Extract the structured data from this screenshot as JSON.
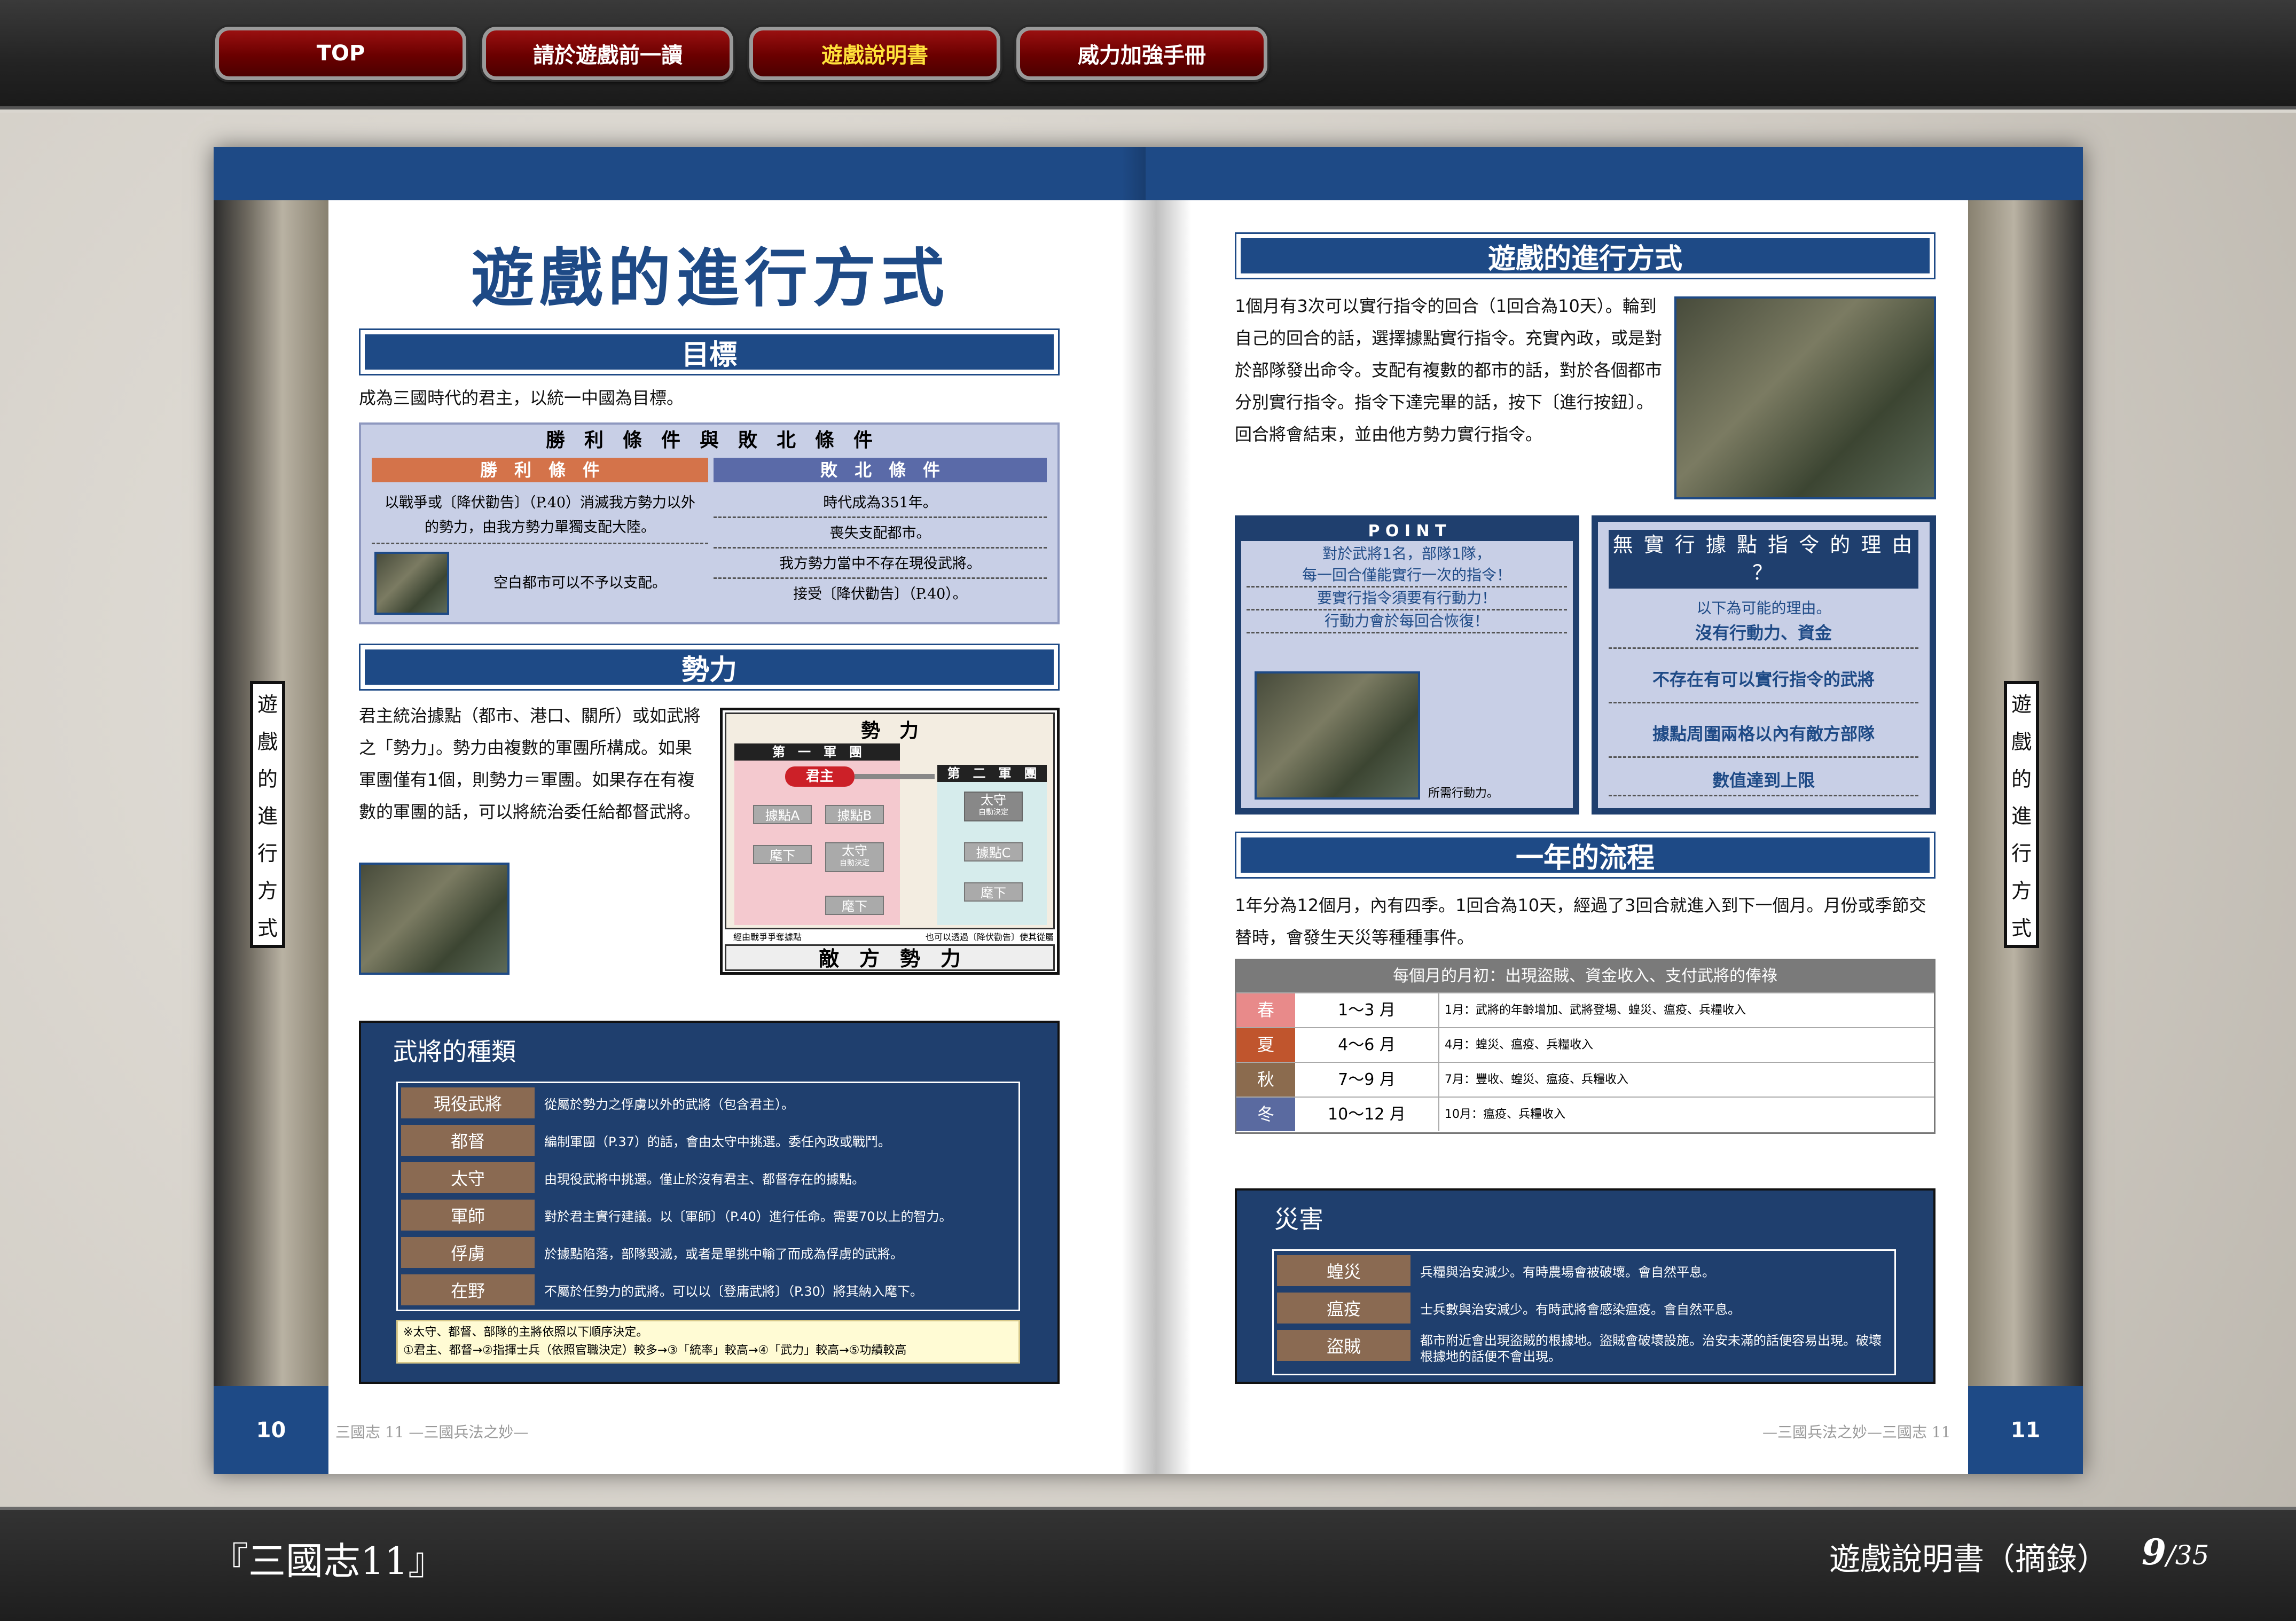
{
  "nav": {
    "items": [
      {
        "label": "TOP"
      },
      {
        "label": "請於遊戲前一讀"
      },
      {
        "label": "遊戲說明書"
      },
      {
        "label": "威力加強手冊"
      }
    ],
    "active_index": 2
  },
  "footer": {
    "title": "『三國志11』",
    "section": "遊戲說明書（摘錄）",
    "page_current": "9",
    "page_total": "/35"
  },
  "left_page": {
    "page_number": "10",
    "running_head": "三國志 11 —三國兵法之妙—",
    "side_tab": [
      "遊",
      "戲",
      "的",
      "進",
      "行",
      "方",
      "式"
    ],
    "title": "遊戲的進行方式",
    "goal": {
      "heading": "目標",
      "text": "成為三國時代的君主，以統一中國為目標。",
      "table_title": "勝　利　條　件　與　敗　北　條　件",
      "win_header": "勝　利　條　件",
      "lose_header": "敗　北　條　件",
      "win_1": "以戰爭或〔降伏勸告〕（P.40）消滅我方勢力以外的勢力，由我方勢力單獨支配大陸。",
      "win_2": "空白都市可以不予以支配。",
      "lose": [
        "時代成為351年。",
        "喪失支配都市。",
        "我方勢力當中不存在現役武將。",
        "接受〔降伏勸告〕（P.40）。"
      ]
    },
    "power": {
      "heading": "勢力",
      "text": "君主統治據點（都市、港口、關所）或如武將之「勢力」。勢力由複數的軍團所構成。如果軍團僅有1個，則勢力＝軍團。如果存在有複數的軍團的話，可以將統治委任給都督武將。",
      "diagram": {
        "title": "勢　力",
        "corps1": "第　一　軍　團",
        "corps2": "第　二　軍　團",
        "lord": "君主",
        "baseA": "據點A",
        "baseB": "據點B",
        "sub1": "麾下",
        "taishou1": "太守",
        "taishou1_note": "自動決定",
        "sub2": "麾下",
        "taishou2": "太守",
        "taishou2_note": "自動決定",
        "baseC": "據點C",
        "sub3": "麾下",
        "note_left": "經由戰爭爭奪據點",
        "note_right": "也可以透過〔降伏勸告〕使其從屬",
        "enemy": "敵　方　勢　力"
      }
    },
    "generals": {
      "heading": "武將的種類",
      "rows": [
        {
          "label": "現役武將",
          "desc": "從屬於勢力之俘虜以外的武將（包含君主）。"
        },
        {
          "label": "都督",
          "desc": "編制軍團（P.37）的話，會由太守中挑選。委任內政或戰鬥。"
        },
        {
          "label": "太守",
          "desc": "由現役武將中挑選。僅止於沒有君主、都督存在的據點。"
        },
        {
          "label": "軍師",
          "desc": "對於君主實行建議。以〔軍師〕（P.40）進行任命。需要70以上的智力。"
        },
        {
          "label": "俘虜",
          "desc": "於據點陷落，部隊毀滅，或者是單挑中輸了而成為俘虜的武將。"
        },
        {
          "label": "在野",
          "desc": "不屬於任勢力的武將。可以以〔登庸武將〕（P.30）將其納入麾下。"
        }
      ],
      "note_1": "※太守、都督、部隊的主將依照以下順序決定。",
      "note_2": "①君主、都督→②指揮士兵（依照官職決定）較多→③「統率」較高→④「武力」較高→⑤功績較高"
    }
  },
  "right_page": {
    "page_number": "11",
    "running_head": "—三國兵法之妙—三國志 11",
    "side_tab": [
      "遊",
      "戲",
      "的",
      "進",
      "行",
      "方",
      "式"
    ],
    "progress": {
      "heading": "遊戲的進行方式",
      "text": "1個月有3次可以實行指令的回合（1回合為10天）。輪到自己的回合的話，選擇據點實行指令。充實內政，或是對於部隊發出命令。支配有複數的都市的話，對於各個都市分別實行指令。指令下達完畢的話，按下〔進行按鈕〕。回合將會結束，並由他方勢力實行指令。"
    },
    "point": {
      "title": "P O I N T",
      "lines": [
        "對於武將1名，部隊1隊，",
        "每一回合僅能實行一次的指令！",
        "要實行指令須要有行動力！",
        "行動力會於每回合恢復！"
      ],
      "caption": "所需行動力。"
    },
    "reasons": {
      "title": "無 實 行 據 點 指 令 的 理 由 ？",
      "intro": "以下為可能的理由。",
      "items": [
        "沒有行動力、資金",
        "不存在有可以實行指令的武將",
        "據點周圍兩格以內有敵方部隊",
        "數值達到上限"
      ]
    },
    "year": {
      "heading": "一年的流程",
      "text": "1年分為12個月，內有四季。1回合為10天，經過了3回合就進入到下一個月。月份或季節交替時，會發生天災等種種事件。",
      "table_header": "每個月的月初：出現盜賊、資金收入、支付武將的俸祿",
      "rows": [
        {
          "season": "春",
          "months": "1～3 月",
          "events": "1月：武將的年齡增加、武將登場、蝗災、瘟疫、兵糧收入",
          "color": "#e88a8a"
        },
        {
          "season": "夏",
          "months": "4～6 月",
          "events": "4月：蝗災、瘟疫、兵糧收入",
          "color": "#c0552d"
        },
        {
          "season": "秋",
          "months": "7～9 月",
          "events": "7月：豐收、蝗災、瘟疫、兵糧收入",
          "color": "#8b6b4e"
        },
        {
          "season": "冬",
          "months": "10～12 月",
          "events": "10月：瘟疫、兵糧收入",
          "color": "#5a6aa0"
        }
      ]
    },
    "disaster": {
      "heading": "災害",
      "rows": [
        {
          "label": "蝗災",
          "desc": "兵糧與治安減少。有時農場會被破壞。會自然平息。"
        },
        {
          "label": "瘟疫",
          "desc": "士兵數與治安減少。有時武將會感染瘟疫。會自然平息。"
        },
        {
          "label": "盜賊",
          "desc": "都市附近會出現盜賊的根據地。盜賊會破壞設施。治安未滿的話便容易出現。破壞根據地的話便不會出現。"
        }
      ]
    }
  }
}
